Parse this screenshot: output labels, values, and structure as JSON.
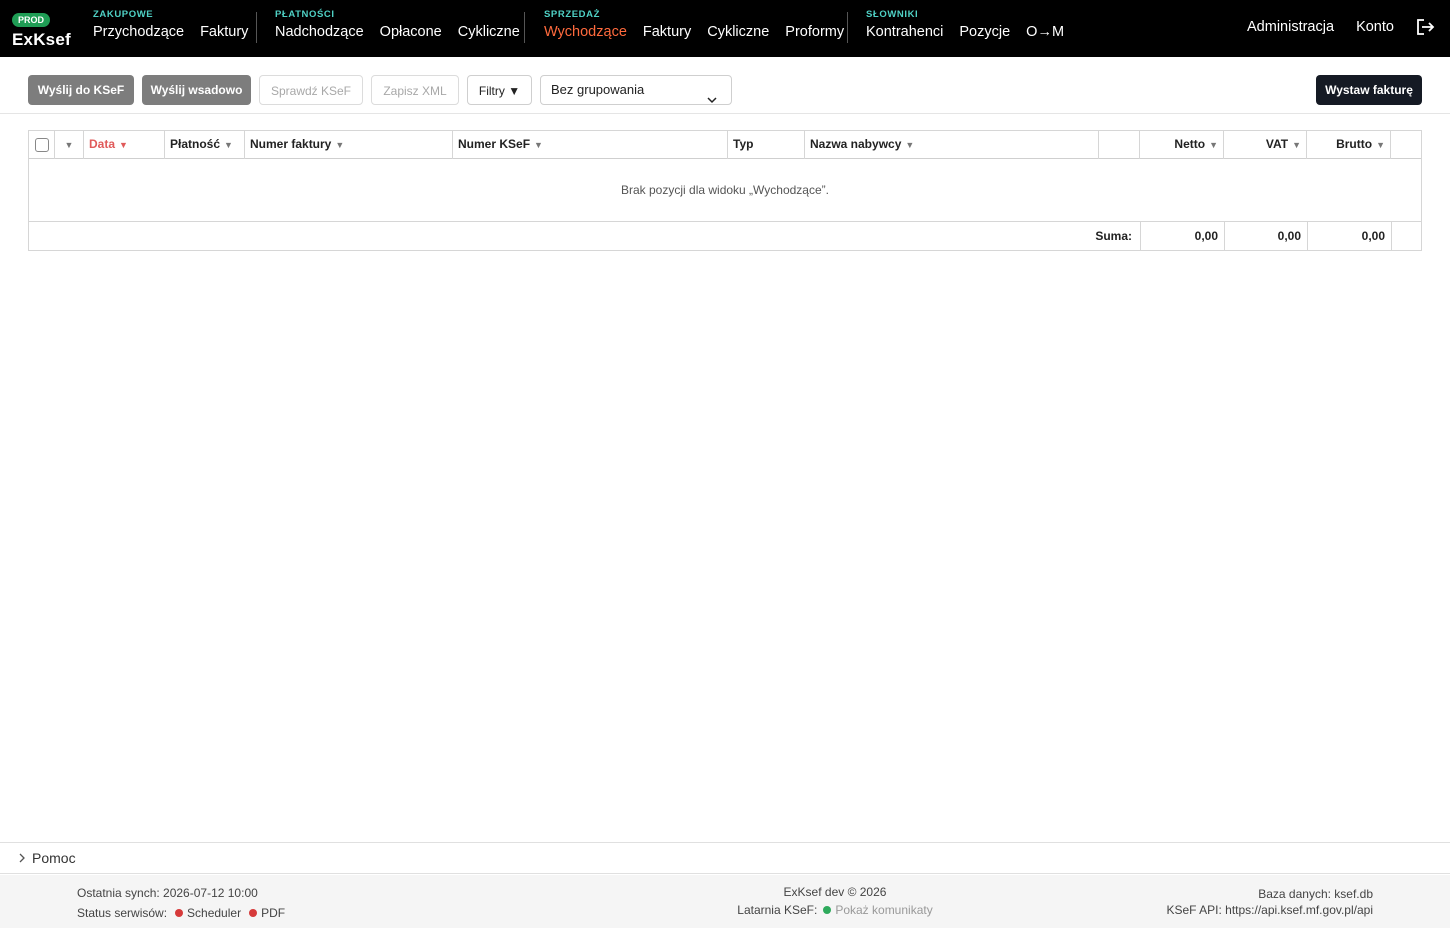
{
  "app": {
    "env_badge": "PROD",
    "name": "ExKsef"
  },
  "nav": {
    "groups": [
      {
        "label": "ZAKUPOWE",
        "items": [
          "Przychodzące",
          "Faktury"
        ]
      },
      {
        "label": "PŁATNOŚCI",
        "items": [
          "Nadchodzące",
          "Opłacone",
          "Cykliczne"
        ]
      },
      {
        "label": "SPRZEDAŻ",
        "items": [
          "Wychodzące",
          "Faktury",
          "Cykliczne",
          "Proformy"
        ],
        "active_index": 0
      },
      {
        "label": "SŁOWNIKI",
        "items": [
          "Kontrahenci",
          "Pozycje",
          "O→M"
        ]
      }
    ],
    "right": {
      "admin": "Administracja",
      "account": "Konto"
    },
    "active_color": "#ff6a3d",
    "group_label_color": "#4fd1c5"
  },
  "toolbar": {
    "send_ksef": "Wyślij do KSeF",
    "send_batch": "Wyślij wsadowo",
    "check_ksef": "Sprawdź KSeF",
    "save_xml": "Zapisz XML",
    "filters": "Filtry ▼",
    "grouping_value": "Bez grupowania",
    "issue_invoice": "Wystaw fakturę"
  },
  "table": {
    "columns": {
      "date": "Data",
      "payment": "Płatność",
      "invoice_number": "Numer faktury",
      "ksef_number": "Numer KSeF",
      "type": "Typ",
      "buyer": "Nazwa nabywcy",
      "net": "Netto",
      "vat": "VAT",
      "gross": "Brutto"
    },
    "sort_arrow": "▼",
    "empty_message": "Brak pozycji dla widoku „Wychodzące”.",
    "sum": {
      "label": "Suma:",
      "net": "0,00",
      "vat": "0,00",
      "gross": "0,00"
    }
  },
  "help": {
    "label": "Pomoc"
  },
  "footer": {
    "last_sync": "Ostatnia synch: 2026-07-12 10:00",
    "services_label": "Status serwisów:",
    "services": [
      {
        "name": "Scheduler",
        "color": "#d63a3a"
      },
      {
        "name": "PDF",
        "color": "#d63a3a"
      }
    ],
    "copyright": "ExKsef dev © 2026",
    "beacon_label": "Latarnia KSeF:",
    "beacon_color": "#2eaa5c",
    "beacon_link": "Pokaż komunikaty",
    "database": "Baza danych: ksef.db",
    "api": "KSeF API: https://api.ksef.mf.gov.pl/api"
  }
}
